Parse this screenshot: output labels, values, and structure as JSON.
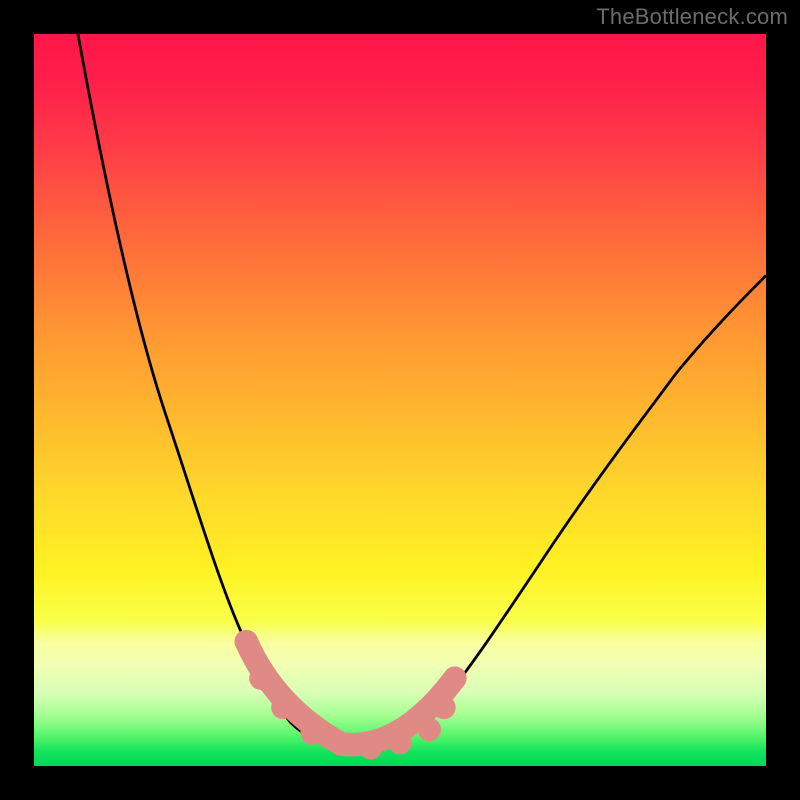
{
  "watermark": "TheBottleneck.com",
  "chart_data": {
    "type": "line",
    "title": "",
    "xlabel": "",
    "ylabel": "",
    "xlim": [
      0,
      100
    ],
    "ylim": [
      0,
      100
    ],
    "grid": false,
    "legend": false,
    "gradient_stops": [
      {
        "pos": 0,
        "color": "#ff1648"
      },
      {
        "pos": 15,
        "color": "#ff3a47"
      },
      {
        "pos": 28,
        "color": "#ff6a3b"
      },
      {
        "pos": 40,
        "color": "#ff9433"
      },
      {
        "pos": 52,
        "color": "#ffb82e"
      },
      {
        "pos": 63,
        "color": "#ffd82a"
      },
      {
        "pos": 73,
        "color": "#fff123"
      },
      {
        "pos": 86,
        "color": "#f1ffb2"
      },
      {
        "pos": 93,
        "color": "#a7ff93"
      },
      {
        "pos": 100,
        "color": "#00d858"
      }
    ],
    "series": [
      {
        "name": "bottleneck-curve",
        "color": "#000000",
        "x": [
          6,
          8,
          10,
          12,
          14,
          16,
          18,
          20,
          22,
          24,
          26,
          28,
          30,
          32,
          34,
          36,
          38,
          40,
          44,
          48,
          52,
          56,
          60,
          64,
          68,
          72,
          76,
          80,
          84,
          88,
          92,
          96,
          100
        ],
        "y": [
          100,
          90,
          80,
          71,
          63,
          56,
          49,
          43,
          37,
          32,
          27,
          23,
          19,
          15,
          12,
          9.5,
          7,
          5,
          3,
          2.5,
          4,
          7,
          11,
          16,
          22,
          28,
          34,
          40,
          46,
          52,
          57,
          62,
          67
        ]
      }
    ],
    "markers": {
      "name": "bottleneck-low-markers",
      "color": "#e08a85",
      "points": [
        {
          "x": 29,
          "y": 17
        },
        {
          "x": 31,
          "y": 12
        },
        {
          "x": 34,
          "y": 8
        },
        {
          "x": 38,
          "y": 4.5
        },
        {
          "x": 42,
          "y": 3
        },
        {
          "x": 46,
          "y": 2.5
        },
        {
          "x": 50,
          "y": 3.2
        },
        {
          "x": 54,
          "y": 5
        },
        {
          "x": 56,
          "y": 8
        },
        {
          "x": 57.5,
          "y": 12
        }
      ]
    },
    "colors": {
      "curve": "#000000",
      "markers": "#e08a85",
      "frame_bg": "#000000"
    }
  }
}
